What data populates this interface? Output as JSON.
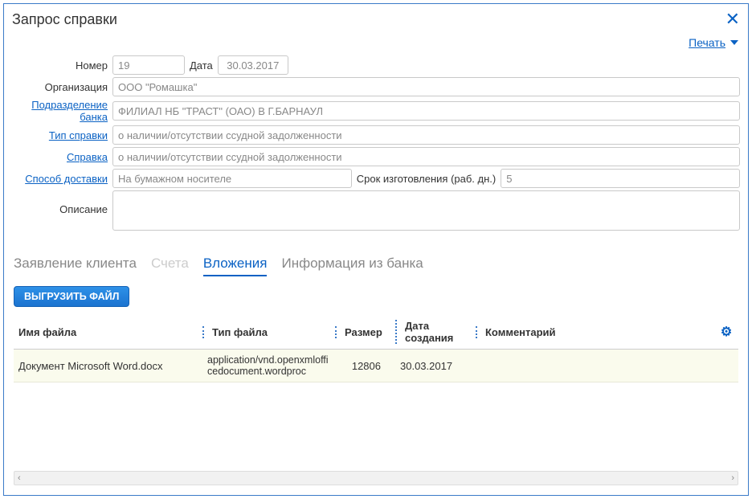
{
  "window": {
    "title": "Запрос справки"
  },
  "toolbar": {
    "print": "Печать"
  },
  "form": {
    "number_label": "Номер",
    "number_value": "19",
    "date_label": "Дата",
    "date_value": "30.03.2017",
    "org_label": "Организация",
    "org_value": "ООО \"Ромашка\"",
    "bank_unit_label": "Подразделение банка",
    "bank_unit_value": "ФИЛИАЛ НБ \"ТРАСТ\" (ОАО) В Г.БАРНАУЛ",
    "cert_type_label": "Тип справки",
    "cert_type_value": "о наличии/отсутствии ссудной задолженности",
    "cert_label": "Справка",
    "cert_value": "о наличии/отсутствии ссудной задолженности",
    "delivery_label": "Способ доставки",
    "delivery_value": "На бумажном носителе",
    "term_label": "Срок изготовления (раб. дн.)",
    "term_value": "5",
    "desc_label": "Описание",
    "desc_value": ""
  },
  "tabs": {
    "client": "Заявление клиента",
    "accounts": "Счета",
    "attachments": "Вложения",
    "bank_info": "Информация из банка"
  },
  "attachments": {
    "upload_label": "ВЫГРУЗИТЬ ФАЙЛ",
    "columns": {
      "name": "Имя файла",
      "type": "Тип файла",
      "size": "Размер",
      "created": "Дата создания",
      "comment": "Комментарий"
    },
    "rows": [
      {
        "name": "Документ Microsoft Word.docx",
        "type": "application/vnd.openxmlofficedocument.wordproc",
        "size": "12806",
        "created": "30.03.2017",
        "comment": ""
      }
    ]
  }
}
